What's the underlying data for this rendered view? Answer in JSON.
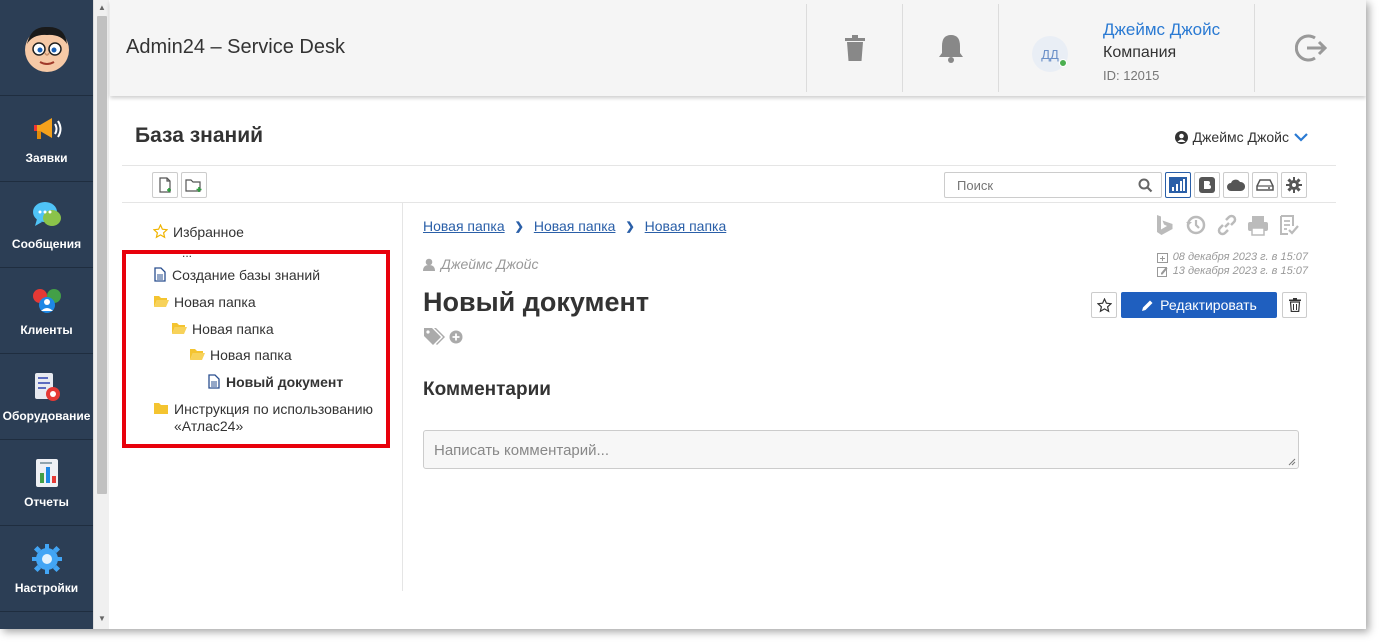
{
  "sidebar": {
    "items": [
      {
        "label": "Заявки",
        "icon": "megaphone-icon"
      },
      {
        "label": "Сообщения",
        "icon": "chat-icon"
      },
      {
        "label": "Клиенты",
        "icon": "clients-icon"
      },
      {
        "label": "Оборудование",
        "icon": "equipment-icon"
      },
      {
        "label": "Отчеты",
        "icon": "report-icon"
      },
      {
        "label": "Настройки",
        "icon": "gear-icon"
      }
    ]
  },
  "header": {
    "title": "Admin24 – Service Desk",
    "user": {
      "initials": "ДД",
      "name": "Джеймс Джойс",
      "company": "Компания",
      "id": "ID: 12015"
    }
  },
  "main": {
    "title": "База знаний",
    "owner": "Джеймс Джойс",
    "search_placeholder": "Поиск"
  },
  "tree": {
    "favorites": "Избранное",
    "ellipsis": "...",
    "items": [
      {
        "label": "Создание базы знаний",
        "type": "doc"
      },
      {
        "label": "Новая папка",
        "type": "folder-open"
      },
      {
        "label": "Новая папка",
        "type": "folder-open"
      },
      {
        "label": "Новая папка",
        "type": "folder-open"
      },
      {
        "label": "Новый документ",
        "type": "doc"
      },
      {
        "label": "Инструкция по использованию «Атлас24»",
        "type": "folder"
      }
    ]
  },
  "document": {
    "breadcrumb": [
      "Новая папка",
      "Новая папка",
      "Новая папка"
    ],
    "author": "Джеймс Джойс",
    "created": "08 декабря 2023 г. в 15:07",
    "modified": "13 декабря 2023 г. в 15:07",
    "title": "Новый документ",
    "edit_label": "Редактировать",
    "comments_title": "Комментарии",
    "comment_placeholder": "Написать комментарий..."
  },
  "colors": {
    "sidebar_bg": "#2c3e55",
    "accent": "#1f5fbf",
    "link": "#2a5fa8",
    "highlight": "#e8000b",
    "folder": "#f4c430"
  }
}
